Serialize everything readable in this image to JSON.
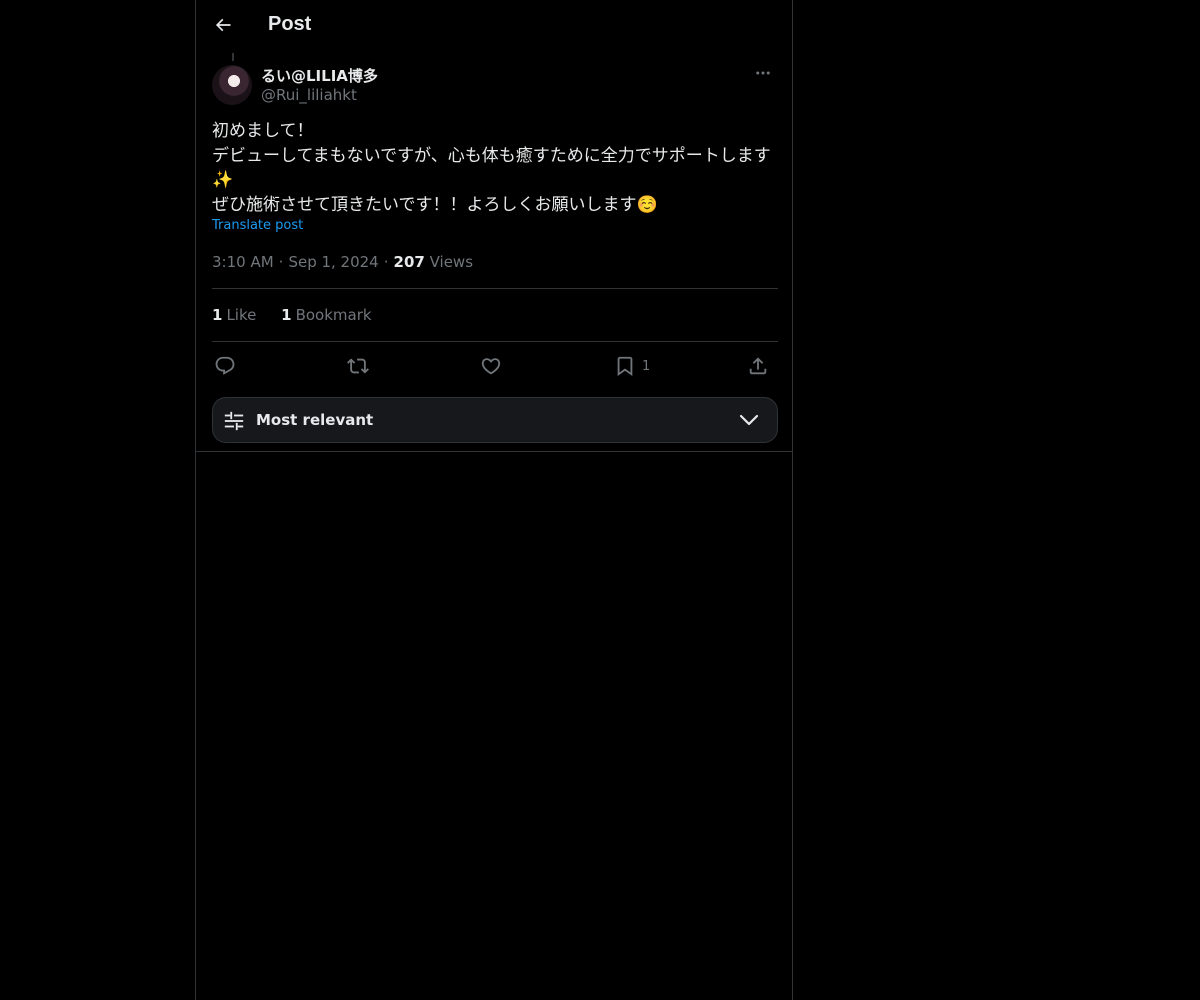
{
  "header": {
    "title": "Post",
    "back_icon": "arrow-left-icon"
  },
  "post": {
    "author": {
      "display_name": "るい@LILIA博多",
      "handle": "@Rui_liliahkt"
    },
    "text_lines": [
      "初めまして！",
      "デビューしてまもないですが、心も体も癒すために全力でサポートします",
      "✨",
      "ぜひ施術させて頂きたいです！！よろしくお願いします☺️"
    ],
    "translate_label": "Translate post",
    "time": "3:10 AM",
    "date": "Sep 1, 2024",
    "views_count": "207",
    "views_label": "Views",
    "separator": "·"
  },
  "stats": {
    "likes_count": "1",
    "likes_label": "Like",
    "bookmarks_count": "1",
    "bookmarks_label": "Bookmark"
  },
  "actions": {
    "reply_icon": "reply-icon",
    "repost_icon": "repost-icon",
    "like_icon": "heart-icon",
    "bookmark_icon": "bookmark-icon",
    "bookmark_count": "1",
    "share_icon": "share-icon"
  },
  "sort": {
    "label": "Most relevant",
    "icon": "sliders-icon",
    "chevron": "chevron-down-icon"
  },
  "colors": {
    "background": "#000000",
    "text_primary": "#e7e9ea",
    "text_secondary": "#71767b",
    "accent": "#1d9bf0",
    "border": "#2f3336"
  }
}
